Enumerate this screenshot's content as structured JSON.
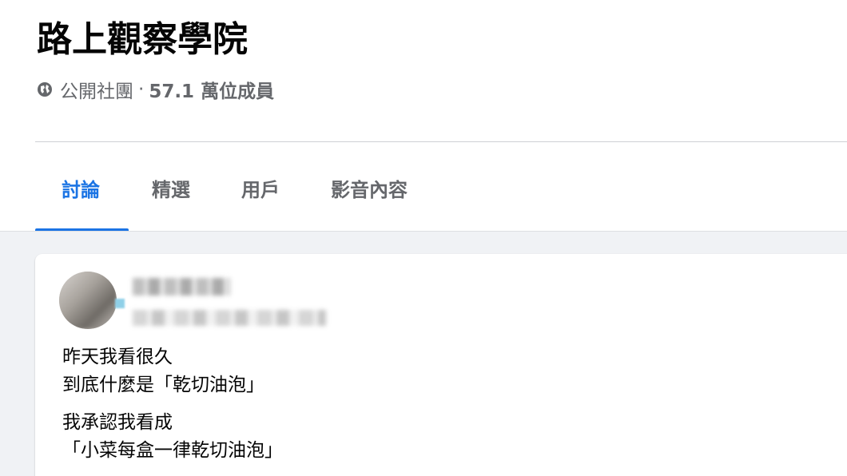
{
  "group": {
    "name": "路上觀察學院",
    "privacy": "公開社團",
    "separator": "·",
    "members": "57.1 萬位成員",
    "icon": "globe-icon"
  },
  "tabs": [
    {
      "label": "討論",
      "active": true
    },
    {
      "label": "精選",
      "active": false
    },
    {
      "label": "用戶",
      "active": false
    },
    {
      "label": "影音內容",
      "active": false
    }
  ],
  "post": {
    "paragraphs": [
      [
        "昨天我看很久",
        "到底什麼是「乾切油泡」"
      ],
      [
        "我承認我看成",
        "「小菜每盒一律乾切油泡」"
      ]
    ]
  },
  "colors": {
    "accent": "#1b74e4",
    "text_secondary": "#65676b",
    "feed_background": "#f0f2f5"
  }
}
